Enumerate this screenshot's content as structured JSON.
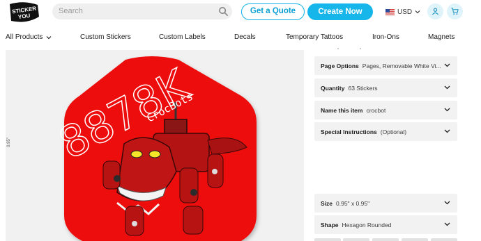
{
  "header": {
    "logo_text": "STICKER YOU",
    "search_placeholder": "Search",
    "quote_button": "Get a Quote",
    "create_button": "Create Now",
    "currency": "USD"
  },
  "nav": {
    "all_products": "All Products",
    "items": [
      "Custom Stickers",
      "Custom Labels",
      "Decals",
      "Temporary Tattoos",
      "Iron-Ons",
      "Magnets"
    ]
  },
  "preview": {
    "dimension_label": "0.95\"",
    "sticker_main_text": "8878K",
    "sticker_sub_text": "CrocBots",
    "sticker_color": "#ee0d0d"
  },
  "options": [
    {
      "key": "Page Options",
      "value": "Pages, Removable White Vi..."
    },
    {
      "key": "Quantity",
      "value": "63 Stickers"
    },
    {
      "key": "Name this item",
      "value": "crocbot"
    },
    {
      "key": "Special Instructions",
      "value": "(Optional)"
    },
    {
      "key": "Size",
      "value": "0.95\" x 0.95\""
    },
    {
      "key": "Shape",
      "value": "Hexagon Rounded"
    }
  ],
  "colors": {
    "accent": "#16b5ea",
    "panel": "#f2f2f2"
  }
}
